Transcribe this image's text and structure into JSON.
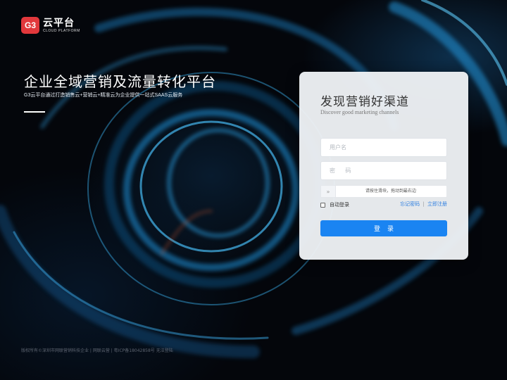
{
  "brand": {
    "logo_mark": "G3",
    "name_cn": "云平台",
    "name_en": "CLOUD PLATFORM",
    "accent": "#e2383c"
  },
  "hero": {
    "title": "企业全域营销及流量转化平台",
    "subtitle": "G3云平台通过打造销售云+营销云+精准云为企业提供一站式SAAS云服务"
  },
  "login": {
    "title": "发现营销好渠道",
    "subtitle": "Discover good marketing channels",
    "username_placeholder": "用户名",
    "password_placeholder": "密 码",
    "slider_handle": "»",
    "slider_text": "请按住滑块，拖动到最右边",
    "remember_label": "自动登录",
    "forgot_link": "忘记密码",
    "link_separator": "|",
    "register_link": "立即注册",
    "submit_label": "登录",
    "primary_color": "#1a84f2"
  },
  "footer": {
    "text": "版权所有©深圳市网联营销科技企业 | 网联云营 | 粤ICP备18042858号  无法登陆"
  }
}
